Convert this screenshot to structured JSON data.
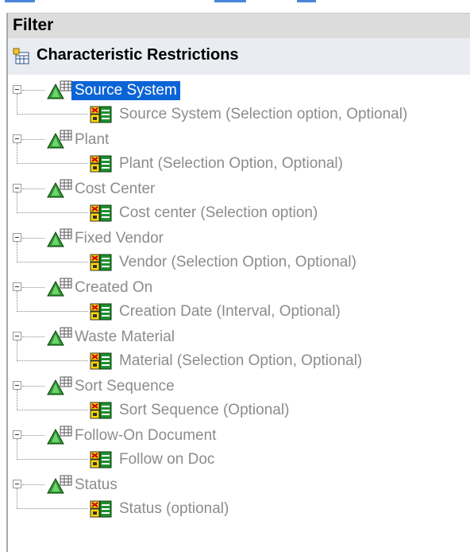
{
  "filter": {
    "title": "Filter"
  },
  "section": {
    "title": "Characteristic Restrictions"
  },
  "colors": {
    "selection": "#0a64d6",
    "text_gray": "#8c8c8c",
    "header_bg": "#dcdcdc"
  },
  "tree": [
    {
      "label": "Source System",
      "child": "Source System (Selection option, Optional)",
      "selected": true
    },
    {
      "label": "Plant",
      "child": "Plant (Selection Option, Optional)"
    },
    {
      "label": "Cost Center",
      "child": "Cost center (Selection option)"
    },
    {
      "label": "Fixed Vendor",
      "child": "Vendor (Selection Option, Optional)"
    },
    {
      "label": "Created On",
      "child": "Creation Date (Interval, Optional)"
    },
    {
      "label": "Waste Material",
      "child": "Material (Selection Option, Optional)"
    },
    {
      "label": "Sort Sequence",
      "child": "Sort Sequence (Optional)"
    },
    {
      "label": "Follow-On Document",
      "child": "Follow on Doc"
    },
    {
      "label": "Status",
      "child": "Status (optional)"
    }
  ]
}
